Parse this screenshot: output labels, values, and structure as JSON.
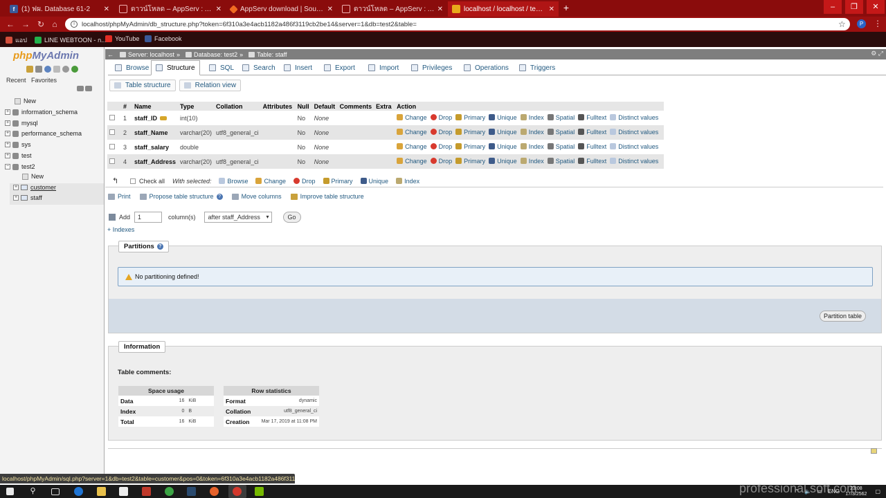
{
  "browser": {
    "tabs": [
      {
        "title": "(1) ฟผ. Database 61-2",
        "icon": "facebook-icon",
        "color": "#3b5998"
      },
      {
        "title": "ดาวน์โหลด – AppServ : Apache -",
        "icon": "page-icon",
        "color": "#c72424"
      },
      {
        "title": "AppServ download | SourceForg",
        "icon": "sourceforge-icon",
        "color": "#f06b22"
      },
      {
        "title": "ดาวน์โหลด – AppServ : Apache -",
        "icon": "page-icon",
        "color": "#c72424"
      },
      {
        "title": "localhost / localhost / test2 / sta",
        "icon": "phpmyadmin-icon",
        "color": "#e8a91b"
      }
    ],
    "url": "localhost/phpMyAdmin/db_structure.php?token=6f310a3e4acb1182a486f3119cb2be14&server=1&db=test2&table=",
    "profile_initial": "P",
    "bookmarks": [
      {
        "label": "แอป",
        "color": "#d54f3c"
      },
      {
        "label": "LINE WEBTOON - ก...",
        "color": "#22b14c"
      },
      {
        "label": "YouTube",
        "color": "#e22d24"
      },
      {
        "label": "Facebook",
        "color": "#3b5998"
      }
    ],
    "status_url": "localhost/phpMyAdmin/sql.php?server=1&db=test2&table=customer&pos=0&token=6f310a3e4acb1182a486f3119c..."
  },
  "nav": {
    "logo_php": "php",
    "logo_myadmin": "MyAdmin",
    "recent": "Recent",
    "favorites": "Favorites",
    "tree": [
      {
        "label": "New"
      },
      {
        "label": "information_schema"
      },
      {
        "label": "mysql"
      },
      {
        "label": "performance_schema"
      },
      {
        "label": "sys"
      },
      {
        "label": "test"
      },
      {
        "label": "test2"
      },
      {
        "label": "New"
      },
      {
        "label": "customer"
      },
      {
        "label": "staff"
      }
    ]
  },
  "breadcrumb": {
    "server": "Server: localhost",
    "database": "Database: test2",
    "table": "Table: staff"
  },
  "tabs": [
    {
      "label": "Browse"
    },
    {
      "label": "Structure"
    },
    {
      "label": "SQL"
    },
    {
      "label": "Search"
    },
    {
      "label": "Insert"
    },
    {
      "label": "Export"
    },
    {
      "label": "Import"
    },
    {
      "label": "Privileges"
    },
    {
      "label": "Operations"
    },
    {
      "label": "Triggers"
    }
  ],
  "subtabs": {
    "table_structure": "Table structure",
    "relation_view": "Relation view"
  },
  "columns": {
    "num": "#",
    "name": "Name",
    "type": "Type",
    "collation": "Collation",
    "attributes": "Attributes",
    "null": "Null",
    "default": "Default",
    "comments": "Comments",
    "extra": "Extra",
    "action": "Action"
  },
  "rows": [
    {
      "num": "1",
      "name": "staff_ID",
      "type": "int(10)",
      "collation": "",
      "null": "No",
      "default": "None"
    },
    {
      "num": "2",
      "name": "staff_Name",
      "type": "varchar(20)",
      "collation": "utf8_general_ci",
      "null": "No",
      "default": "None"
    },
    {
      "num": "3",
      "name": "staff_salary",
      "type": "double",
      "collation": "",
      "null": "No",
      "default": "None"
    },
    {
      "num": "4",
      "name": "staff_Address",
      "type": "varchar(20)",
      "collation": "utf8_general_ci",
      "null": "No",
      "default": "None"
    }
  ],
  "actions": {
    "change": "Change",
    "drop": "Drop",
    "primary": "Primary",
    "unique": "Unique",
    "index": "Index",
    "spatial": "Spatial",
    "fulltext": "Fulltext",
    "distinct": "Distinct values"
  },
  "with_selected": {
    "check_all": "Check all",
    "label": "With selected:",
    "browse": "Browse",
    "change": "Change",
    "drop": "Drop",
    "primary": "Primary",
    "unique": "Unique",
    "index": "Index"
  },
  "tools": {
    "print": "Print",
    "propose": "Propose table structure",
    "move": "Move columns",
    "improve": "Improve table structure"
  },
  "add_columns": {
    "label": "Add",
    "count": "1",
    "unit": "column(s)",
    "position": "after staff_Address",
    "go": "Go"
  },
  "indexes_link": "+ Indexes",
  "partitions": {
    "legend": "Partitions",
    "note": "No partitioning defined!",
    "button": "Partition table"
  },
  "information": {
    "legend": "Information",
    "comments_label": "Table comments:",
    "space_usage": {
      "title": "Space usage",
      "rows": [
        {
          "label": "Data",
          "value": "16",
          "unit": "KiB"
        },
        {
          "label": "Index",
          "value": "0",
          "unit": "B"
        },
        {
          "label": "Total",
          "value": "16",
          "unit": "KiB"
        }
      ]
    },
    "row_statistics": {
      "title": "Row statistics",
      "rows": [
        {
          "label": "Format",
          "value": "dynamic"
        },
        {
          "label": "Collation",
          "value": "utf8_general_ci"
        },
        {
          "label": "Creation",
          "value": "Mar 17, 2019 at 11:08 PM"
        }
      ]
    }
  },
  "taskbar": {
    "lang": "ENG",
    "time": "23:08",
    "date": "17/3/2562"
  },
  "watermark": "professional soft.com"
}
